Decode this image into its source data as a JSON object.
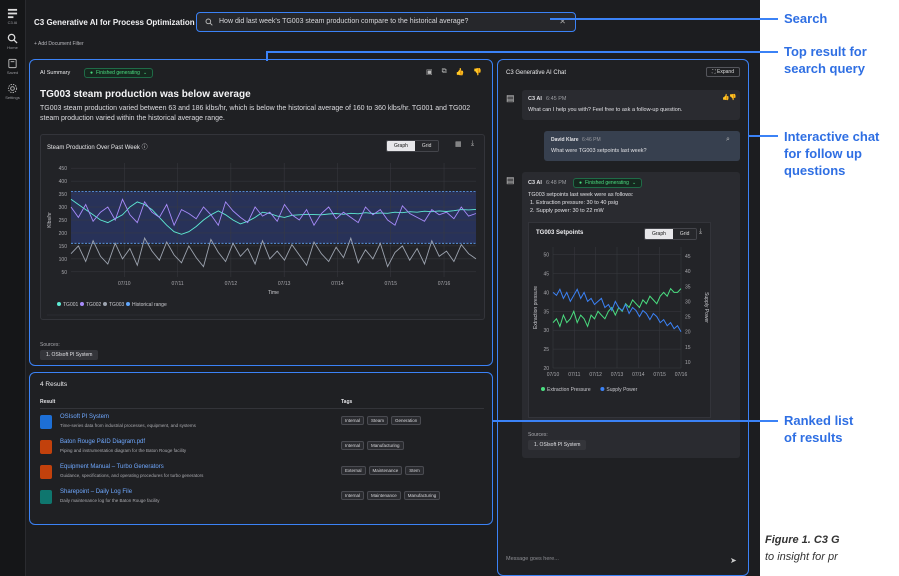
{
  "rail": {
    "items": [
      {
        "label": "C3 AI",
        "icon": "logo-icon"
      },
      {
        "label": "Home",
        "icon": "search-icon"
      },
      {
        "label": "Saved",
        "icon": "bookmark-icon"
      },
      {
        "label": "Settings",
        "icon": "gear-icon"
      }
    ]
  },
  "header": {
    "title": "C3 Generative AI for Process Optimization",
    "search_value": "How did last week's TG003 steam production compare to the historical average?",
    "add_filter": "+ Add Document Filter"
  },
  "summary": {
    "label": "AI Summary",
    "status": "Finished generating",
    "headline": "TG003 steam production was below average",
    "body": "TG003 steam production varied between 63 and 186 klbs/hr, which is below the historical average of 160 to 360 klbs/hr. TG001 and TG002 steam production varied within the historical average range.",
    "chart_title": "Steam Production Over Past Week ⓘ",
    "toggle_graph": "Graph",
    "toggle_grid": "Grid",
    "sources_label": "Sources:",
    "source_chip": "1. OSIsoft PI System"
  },
  "chart_data": [
    {
      "type": "line",
      "title": "Steam Production Over Past Week",
      "xlabel": "Time",
      "ylabel": "Klbs/hr",
      "x_ticks": [
        "07/10",
        "07/11",
        "07/12",
        "07/13",
        "07/14",
        "07/15",
        "07/16"
      ],
      "y_ticks": [
        50,
        100,
        150,
        200,
        250,
        300,
        350,
        400,
        450
      ],
      "ylim": [
        30,
        470
      ],
      "historical_range": [
        160,
        360
      ],
      "legend_position": "bottom-left",
      "series": [
        {
          "name": "TG001",
          "color": "#5eead4",
          "values": [
            330,
            310,
            290,
            270,
            250,
            240,
            255,
            270,
            300,
            320,
            310,
            290,
            260,
            230,
            205,
            195,
            205,
            225,
            250,
            270,
            285,
            270,
            250,
            235,
            245,
            260,
            280,
            275,
            265,
            260,
            268,
            270,
            272,
            271,
            270,
            273,
            275,
            272,
            276,
            274,
            278,
            275,
            277,
            276,
            280,
            278,
            282,
            280,
            284,
            282,
            285,
            283,
            286,
            290,
            289,
            291
          ]
        },
        {
          "name": "TG002",
          "color": "#a78bfa",
          "values": [
            300,
            260,
            310,
            245,
            280,
            300,
            250,
            330,
            270,
            240,
            320,
            280,
            260,
            310,
            230,
            290,
            275,
            255,
            300,
            270,
            230,
            320,
            285,
            260,
            240,
            300,
            265,
            280,
            245,
            310,
            270,
            250,
            290,
            230,
            275,
            300,
            255,
            280,
            260,
            240,
            300,
            270,
            290,
            250,
            230,
            305,
            275,
            260,
            245,
            290,
            270,
            280,
            255,
            300,
            265,
            275
          ]
        },
        {
          "name": "TG003",
          "color": "#9ca3af",
          "values": [
            120,
            150,
            90,
            170,
            110,
            80,
            160,
            100,
            140,
            75,
            180,
            130,
            95,
            165,
            115,
            85,
            150,
            105,
            70,
            175,
            125,
            90,
            160,
            110,
            140,
            80,
            170,
            100,
            130,
            95,
            155,
            115,
            75,
            165,
            120,
            90,
            145,
            105,
            180,
            85,
            135,
            100,
            160,
            70,
            125,
            150,
            95,
            140,
            80,
            170,
            110,
            130,
            90,
            155,
            120,
            100
          ]
        }
      ]
    },
    {
      "type": "line",
      "title": "TG003 Setpoints",
      "x_ticks": [
        "07/10",
        "07/11",
        "07/12",
        "07/13",
        "07/14",
        "07/15",
        "07/16"
      ],
      "ylabel": "Extraction pressure",
      "y2label": "Supply Power",
      "y_ticks": [
        20,
        25,
        30,
        35,
        40,
        45,
        50
      ],
      "y2_ticks": [
        10,
        15,
        20,
        25,
        30,
        35,
        40,
        45
      ],
      "ylim": [
        20,
        52
      ],
      "y2lim": [
        8,
        48
      ],
      "legend_position": "bottom",
      "series": [
        {
          "name": "Extraction Pressure",
          "axis": "left",
          "color": "#4ade80",
          "values": [
            32,
            33,
            31,
            34,
            32,
            33,
            35,
            32,
            34,
            33,
            31,
            34,
            33,
            35,
            34,
            33,
            35,
            36,
            34,
            36,
            35,
            37,
            36,
            38,
            37,
            36,
            38,
            37,
            39,
            38,
            37,
            39,
            40,
            39,
            41,
            40,
            40,
            41
          ]
        },
        {
          "name": "Supply Power",
          "axis": "right",
          "color": "#3b82f6",
          "values": [
            33,
            32,
            34,
            31,
            33,
            30,
            32,
            34,
            31,
            33,
            30,
            31,
            29,
            30,
            31,
            28,
            29,
            27,
            30,
            28,
            27,
            29,
            26,
            28,
            27,
            25,
            27,
            26,
            24,
            26,
            25,
            23,
            24,
            22,
            23,
            21,
            22,
            20
          ]
        }
      ]
    }
  ],
  "results": {
    "title": "4 Results",
    "col_result": "Result",
    "col_tags": "Tags",
    "items": [
      {
        "title": "OSIsoft PI System",
        "desc": "Time-series data from industrial processes, equipment, and systems",
        "tags": [
          "Internal",
          "Steam",
          "Generation"
        ],
        "icon": "osisoft-logo-icon",
        "icon_color": "#1d6fd6"
      },
      {
        "title": "Baton Rouge P&ID Diagram.pdf",
        "desc": "Piping and instrumentation diagram for the Baton Rouge facility",
        "tags": [
          "Internal",
          "Manufacturing"
        ],
        "icon": "pdf-file-icon",
        "icon_color": "#c2410c"
      },
      {
        "title": "Equipment Manual – Turbo Generators",
        "desc": "Guidance, specifications, and operating procedures for turbo generators",
        "tags": [
          "External",
          "Maintenance",
          "Stem"
        ],
        "icon": "pdf-file-icon",
        "icon_color": "#c2410c"
      },
      {
        "title": "Sharepoint – Daily Log File",
        "desc": "Daily maintenance log for the Baton Rouge facility",
        "tags": [
          "Internal",
          "Maintenance",
          "Manufacturing"
        ],
        "icon": "sharepoint-icon",
        "icon_color": "#0f766e"
      }
    ]
  },
  "chat": {
    "title": "C3 Generative AI Chat",
    "expand": "Expand",
    "m1_author": "C3 AI",
    "m1_time": "6:45 PM",
    "m1_text": "What can I help you with? Feel free to ask a follow-up question.",
    "m2_author": "David Klare",
    "m2_time": "6:46 PM",
    "m2_text": "What were TG003 setpoints last week?",
    "m3_author": "C3 AI",
    "m3_time": "6:48 PM",
    "m3_status": "Finished generating",
    "m3_line1": "TG003 setpoints last week were as follows:",
    "m3_line2": "1. Extraction pressure: 30 to 40 psig",
    "m3_line3": "2. Supply power: 30 to 22 mW",
    "chart_title": "TG003 Setpoints",
    "toggle_graph": "Graph",
    "toggle_grid": "Grid",
    "sources_label": "Sources:",
    "source_chip": "1. OSIsoft PI System",
    "placeholder": "Message goes here..."
  },
  "annotations": {
    "search": "Search",
    "top1": "Top result for",
    "top2": "search query",
    "chat1": "Interactive chat",
    "chat2": "for follow up",
    "chat3": "questions",
    "ranked1": "Ranked list",
    "ranked2": "of results",
    "caption1": "Figure 1.  C3 G",
    "caption2": "to insight for pr"
  },
  "colors": {
    "accent": "#3b82f6",
    "annotation": "#2f6fe3",
    "success": "#4ade80",
    "background": "#1c1d20"
  }
}
